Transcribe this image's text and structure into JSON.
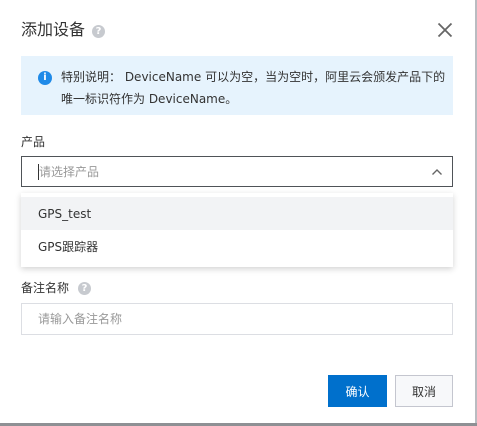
{
  "dialog": {
    "title": "添加设备",
    "help_glyph": "?",
    "close_icon": "close-icon"
  },
  "notice": {
    "icon_glyph": "i",
    "line1": "特别说明： DeviceName 可以为空，当为空时，阿里云会颁发产品下的",
    "line2": "唯一标识符作为 DeviceName。"
  },
  "product_field": {
    "label": "产品",
    "placeholder": "请选择产品",
    "options": [
      "GPS_test",
      "GPS跟踪器"
    ]
  },
  "remark_field": {
    "label": "备注名称",
    "help_glyph": "?",
    "placeholder": "请输入备注名称"
  },
  "buttons": {
    "confirm": "确认",
    "cancel": "取消"
  },
  "colors": {
    "primary": "#0070cc",
    "info": "#1f8ae8",
    "notice_bg": "#e6f3fd"
  }
}
